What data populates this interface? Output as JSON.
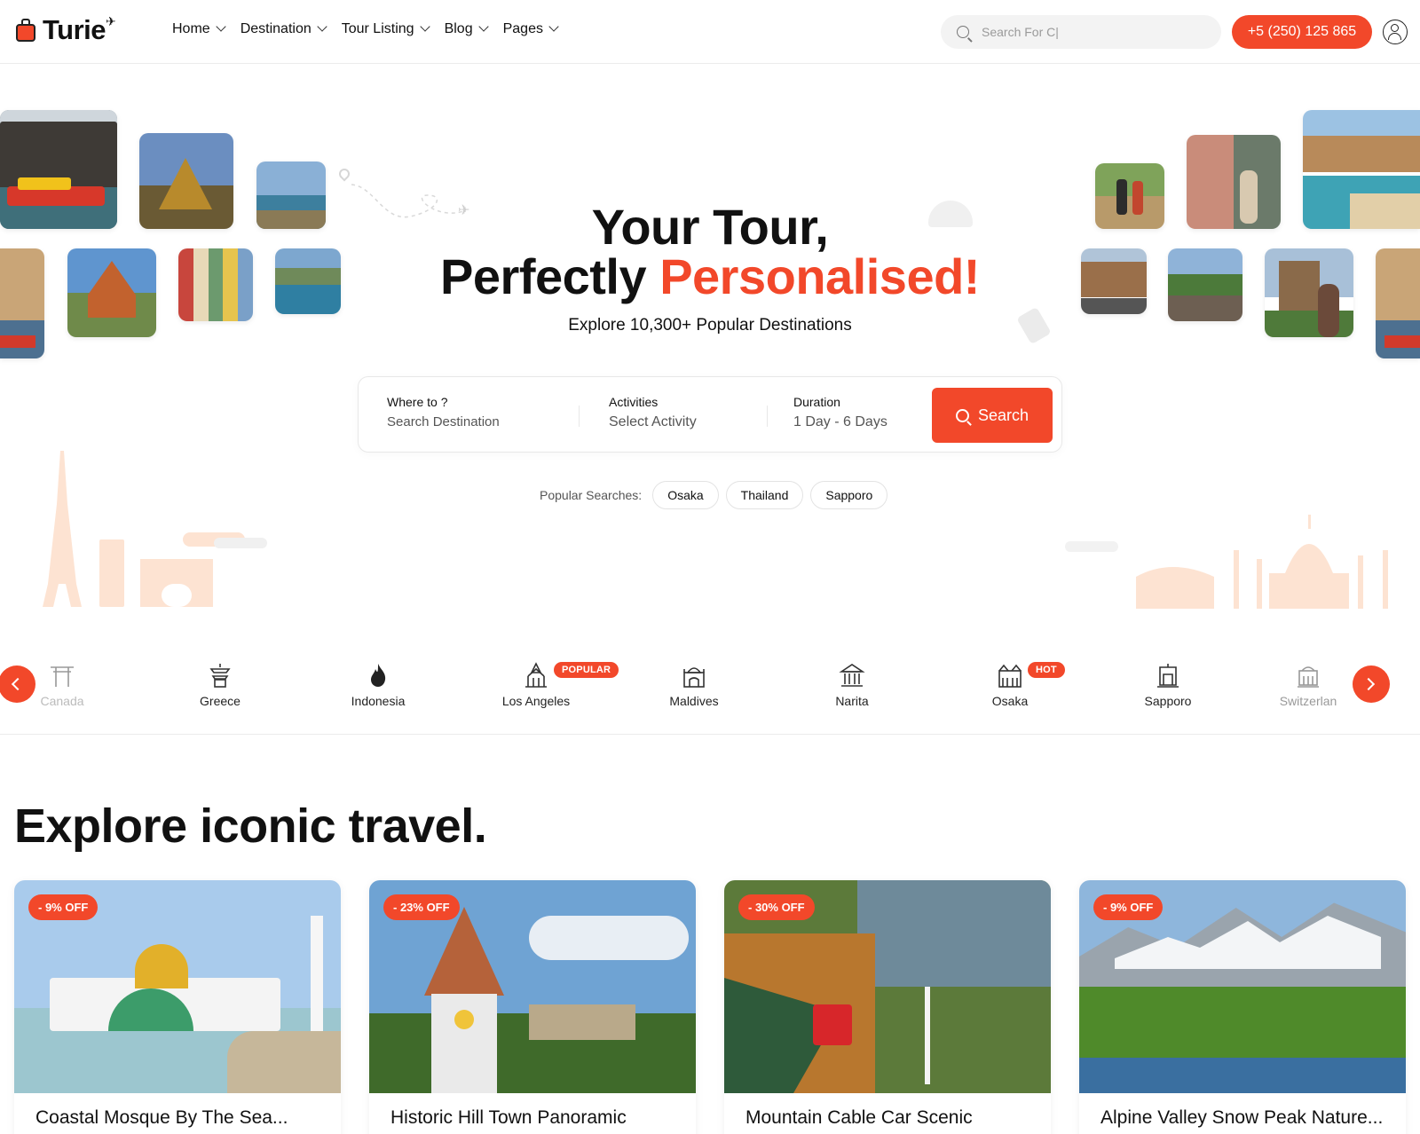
{
  "header": {
    "logo_text": "Turie",
    "nav": [
      {
        "label": "Home"
      },
      {
        "label": "Destination"
      },
      {
        "label": "Tour Listing"
      },
      {
        "label": "Blog"
      },
      {
        "label": "Pages"
      }
    ],
    "search_placeholder": "Search For C|",
    "phone": "+5 (250) 125 865",
    "icons": {
      "search": "search-icon",
      "user": "user-icon",
      "chevron": "chevron-down-icon"
    }
  },
  "hero": {
    "title_line1": "Your Tour,",
    "title_line2_plain": "Perfectly",
    "title_line2_accent": "Personalised!",
    "subtitle": "Explore 10,300+ Popular Destinations",
    "accent_color": "#f2482a"
  },
  "search": {
    "fields": [
      {
        "label": "Where to ?",
        "value": "Search Destination"
      },
      {
        "label": "Activities",
        "value": "Select Activity"
      },
      {
        "label": "Duration",
        "value": "1 Day - 6 Days"
      }
    ],
    "button_label": "Search",
    "popular_label": "Popular Searches:",
    "popular": [
      "Osaka",
      "Thailand",
      "Sapporo"
    ]
  },
  "categories": {
    "items": [
      {
        "label": "Canada",
        "icon": "torii-gate-icon",
        "badge": ""
      },
      {
        "label": "Greece",
        "icon": "pagoda-icon",
        "badge": ""
      },
      {
        "label": "Indonesia",
        "icon": "flame-icon",
        "badge": ""
      },
      {
        "label": "Los Angeles",
        "icon": "temple-icon",
        "badge": "POPULAR"
      },
      {
        "label": "Maldives",
        "icon": "palace-icon",
        "badge": ""
      },
      {
        "label": "Narita",
        "icon": "capitol-icon",
        "badge": ""
      },
      {
        "label": "Osaka",
        "icon": "castle-icon",
        "badge": "HOT"
      },
      {
        "label": "Sapporo",
        "icon": "monument-icon",
        "badge": ""
      },
      {
        "label": "Switzerlan",
        "icon": "building-icon",
        "badge": ""
      }
    ],
    "prev_icon": "chevron-left-icon",
    "next_icon": "chevron-right-icon"
  },
  "explore": {
    "title": "Explore iconic travel.",
    "cards": [
      {
        "discount": "- 9% OFF",
        "title": "Coastal Mosque By The Sea..."
      },
      {
        "discount": "- 23% OFF",
        "title": "Historic Hill Town Panoramic"
      },
      {
        "discount": "- 30% OFF",
        "title": "Mountain Cable Car Scenic"
      },
      {
        "discount": "- 9% OFF",
        "title": "Alpine Valley Snow Peak Nature..."
      }
    ]
  }
}
